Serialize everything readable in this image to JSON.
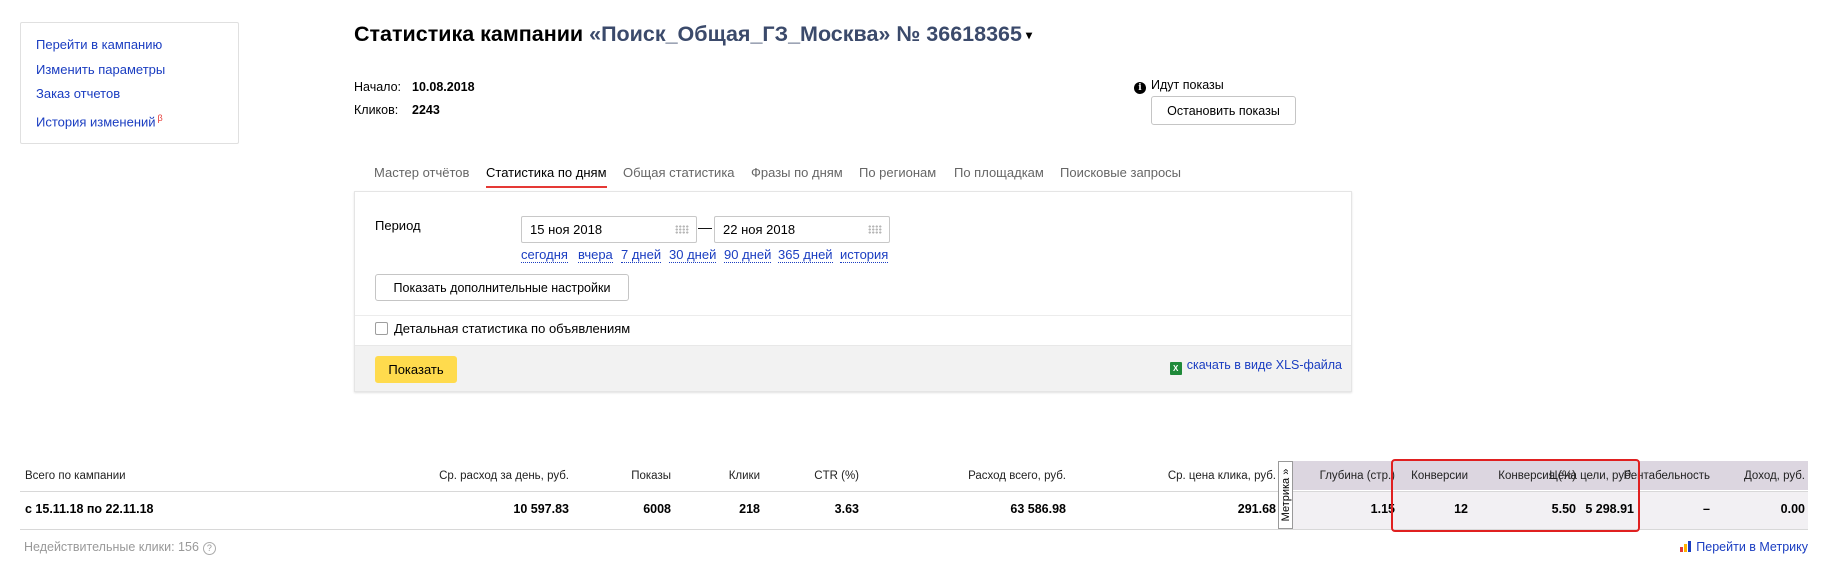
{
  "sidebar": {
    "items": [
      {
        "label": "Перейти в кампанию"
      },
      {
        "label": "Изменить параметры"
      },
      {
        "label": "Заказ отчетов"
      },
      {
        "label": "История изменений",
        "badge": "β"
      }
    ]
  },
  "header": {
    "title_prefix": "Статистика кампании ",
    "campaign_name": "«Поиск_Общая_ГЗ_Москва» № 36618365",
    "caret": "▾"
  },
  "meta": {
    "start_label": "Начало:",
    "start_value": "10.08.2018",
    "clicks_label": "Кликов:",
    "clicks_value": "2243"
  },
  "status": {
    "icon": "info-icon",
    "text": "Идут показы",
    "stop_button": "Остановить показы"
  },
  "tabs": [
    {
      "label": "Мастер отчётов",
      "active": false
    },
    {
      "label": "Статистика по дням",
      "active": true
    },
    {
      "label": "Общая статистика",
      "active": false
    },
    {
      "label": "Фразы по дням",
      "active": false
    },
    {
      "label": "По регионам",
      "active": false
    },
    {
      "label": "По площадкам",
      "active": false
    },
    {
      "label": "Поисковые запросы",
      "active": false
    }
  ],
  "form": {
    "period_label": "Период",
    "date_from": "15 ноя 2018",
    "date_to": "22 ноя 2018",
    "dash": "—",
    "quick_ranges": [
      "сегодня",
      "вчера",
      "7 дней",
      "30 дней",
      "90 дней",
      "365 дней",
      "история"
    ],
    "extra_settings_button": "Показать дополнительные настройки",
    "detailed_checkbox_label": "Детальная статистика по объявлениям",
    "detailed_checked": false,
    "show_button": "Показать",
    "xls_link": "скачать в виде XLS-файла"
  },
  "stats": {
    "headers": {
      "campaign": "Всего по кампании",
      "avg_daily": "Ср. расход за день, руб.",
      "impressions": "Показы",
      "clicks": "Клики",
      "ctr": "CTR (%)",
      "total_spend": "Расход всего, руб.",
      "avg_cpc": "Ср. цена клика, руб.",
      "metrika_tab": "Метрика »",
      "depth": "Глубина (стр.)",
      "conversions": "Конверсии",
      "conversion_rate": "Конверсия (%)",
      "goal_cost": "Цена цели, руб.",
      "profitability": "Рентабельность",
      "revenue": "Доход, руб."
    },
    "row": {
      "period": "с 15.11.18 по 22.11.18",
      "avg_daily": "10 597.83",
      "impressions": "6008",
      "clicks": "218",
      "ctr": "3.63",
      "total_spend": "63 586.98",
      "avg_cpc": "291.68",
      "depth": "1.15",
      "conversions": "12",
      "conversion_rate": "5.50",
      "goal_cost": "5 298.91",
      "profitability": "–",
      "revenue": "0.00"
    },
    "invalid_clicks": "Недействительные клики: 156",
    "metrika_link": "Перейти в Метрику",
    "highlight_color": "#e02020"
  }
}
